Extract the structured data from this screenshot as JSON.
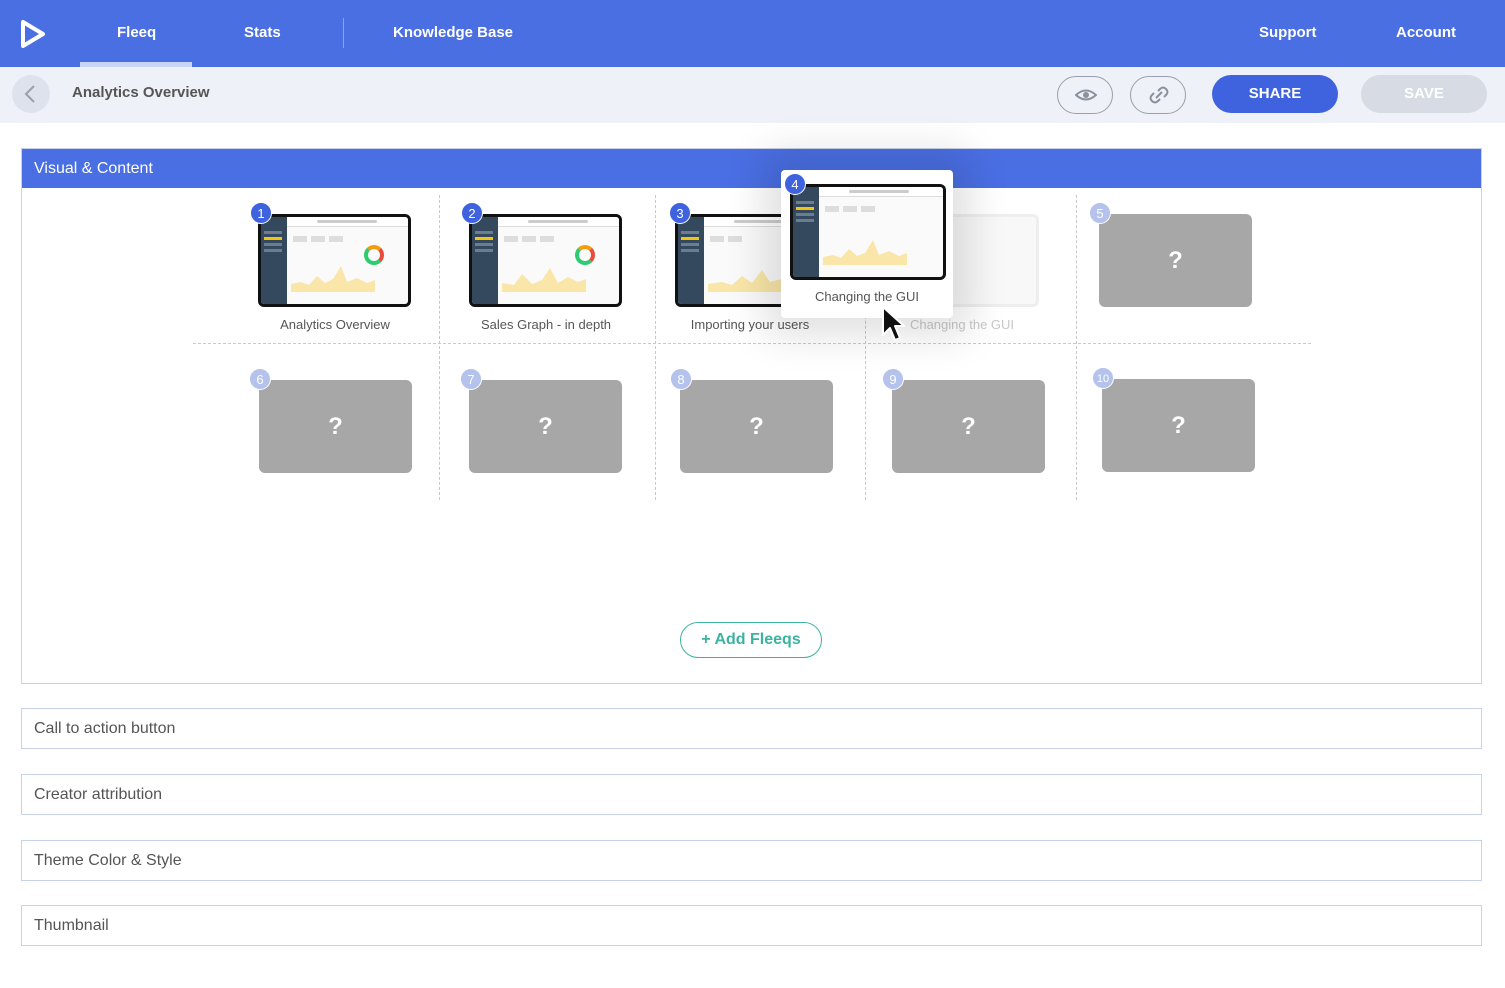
{
  "nav": {
    "items": [
      {
        "label": "Fleeq",
        "active": true
      },
      {
        "label": "Stats"
      },
      {
        "label": "Knowledge Base"
      },
      {
        "label": "Support"
      },
      {
        "label": "Account"
      }
    ]
  },
  "subheader": {
    "title": "Analytics Overview",
    "preview_icon": "eye-icon",
    "link_icon": "link-icon",
    "share_label": "SHARE",
    "save_label": "SAVE"
  },
  "panel": {
    "title": "Visual & Content",
    "slots": [
      {
        "num": "1",
        "caption": "Analytics Overview",
        "filled": true
      },
      {
        "num": "2",
        "caption": "Sales Graph - in depth",
        "filled": true
      },
      {
        "num": "3",
        "caption": "Importing your users",
        "filled": true
      },
      {
        "num": "4",
        "caption": "Changing the GUI",
        "filled": true,
        "ghost": true
      },
      {
        "num": "5",
        "caption": "",
        "filled": false,
        "placeholder": "?"
      },
      {
        "num": "6",
        "placeholder": "?"
      },
      {
        "num": "7",
        "placeholder": "?"
      },
      {
        "num": "8",
        "placeholder": "?"
      },
      {
        "num": "9",
        "placeholder": "?"
      },
      {
        "num": "10",
        "placeholder": "?"
      }
    ],
    "dragging": {
      "num": "4",
      "caption": "Changing the GUI"
    },
    "add_label": "+ Add Fleeqs"
  },
  "sections": [
    {
      "label": "Call to action button"
    },
    {
      "label": "Creator attribution"
    },
    {
      "label": "Theme Color & Style"
    },
    {
      "label": "Thumbnail"
    }
  ],
  "colors": {
    "brand": "#4a6fe3",
    "share": "#3f63df",
    "add": "#3cb3a0",
    "placeholder": "#a7a7a7"
  }
}
